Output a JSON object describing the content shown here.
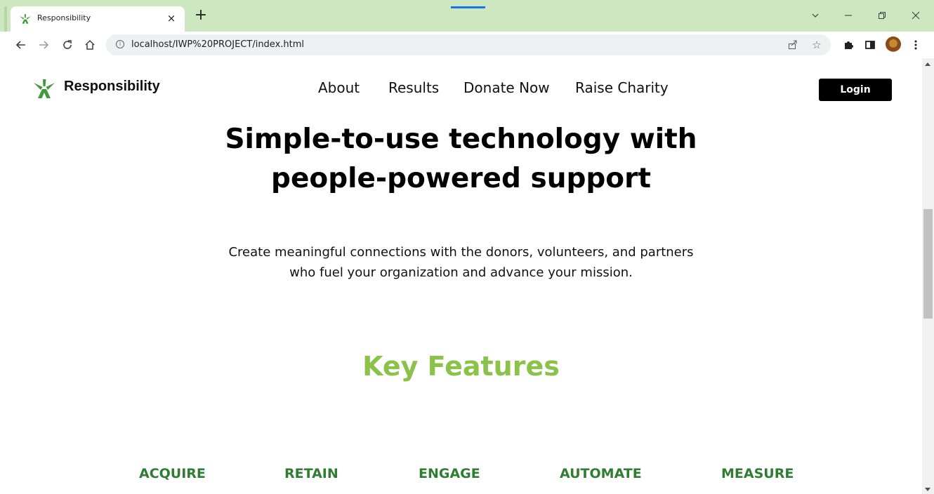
{
  "browser": {
    "tab_title": "Responsibility",
    "tab_close": "×",
    "new_tab": "+",
    "url": "localhost/IWP%20PROJECT/index.html",
    "icons": [
      "back-icon",
      "forward-icon",
      "reload-icon",
      "home-icon",
      "info-icon",
      "share-icon",
      "star-icon",
      "extensions-icon",
      "side-panel-icon",
      "menu-icon"
    ]
  },
  "header": {
    "brand": "Responsibility",
    "nav": [
      {
        "label": "About"
      },
      {
        "label": "Results"
      },
      {
        "label": "Donate Now"
      },
      {
        "label": "Raise Charity"
      }
    ],
    "login_label": "Login"
  },
  "hero": {
    "title_line1": "Simple-to-use technology with",
    "title_line2": "people-powered support",
    "subtitle_line1": "Create meaningful connections with the donors, volunteers, and partners",
    "subtitle_line2": "who fuel your organization and advance your mission."
  },
  "features": {
    "title": "Key Features",
    "items": [
      {
        "label": "ACQUIRE"
      },
      {
        "label": "RETAIN"
      },
      {
        "label": "ENGAGE"
      },
      {
        "label": "AUTOMATE"
      },
      {
        "label": "MEASURE"
      }
    ]
  },
  "colors": {
    "tabbar": "#cde8c0",
    "brand_green": "#3f9a3a",
    "feature_title": "#8bc34a",
    "feature_label": "#2e7d32"
  }
}
